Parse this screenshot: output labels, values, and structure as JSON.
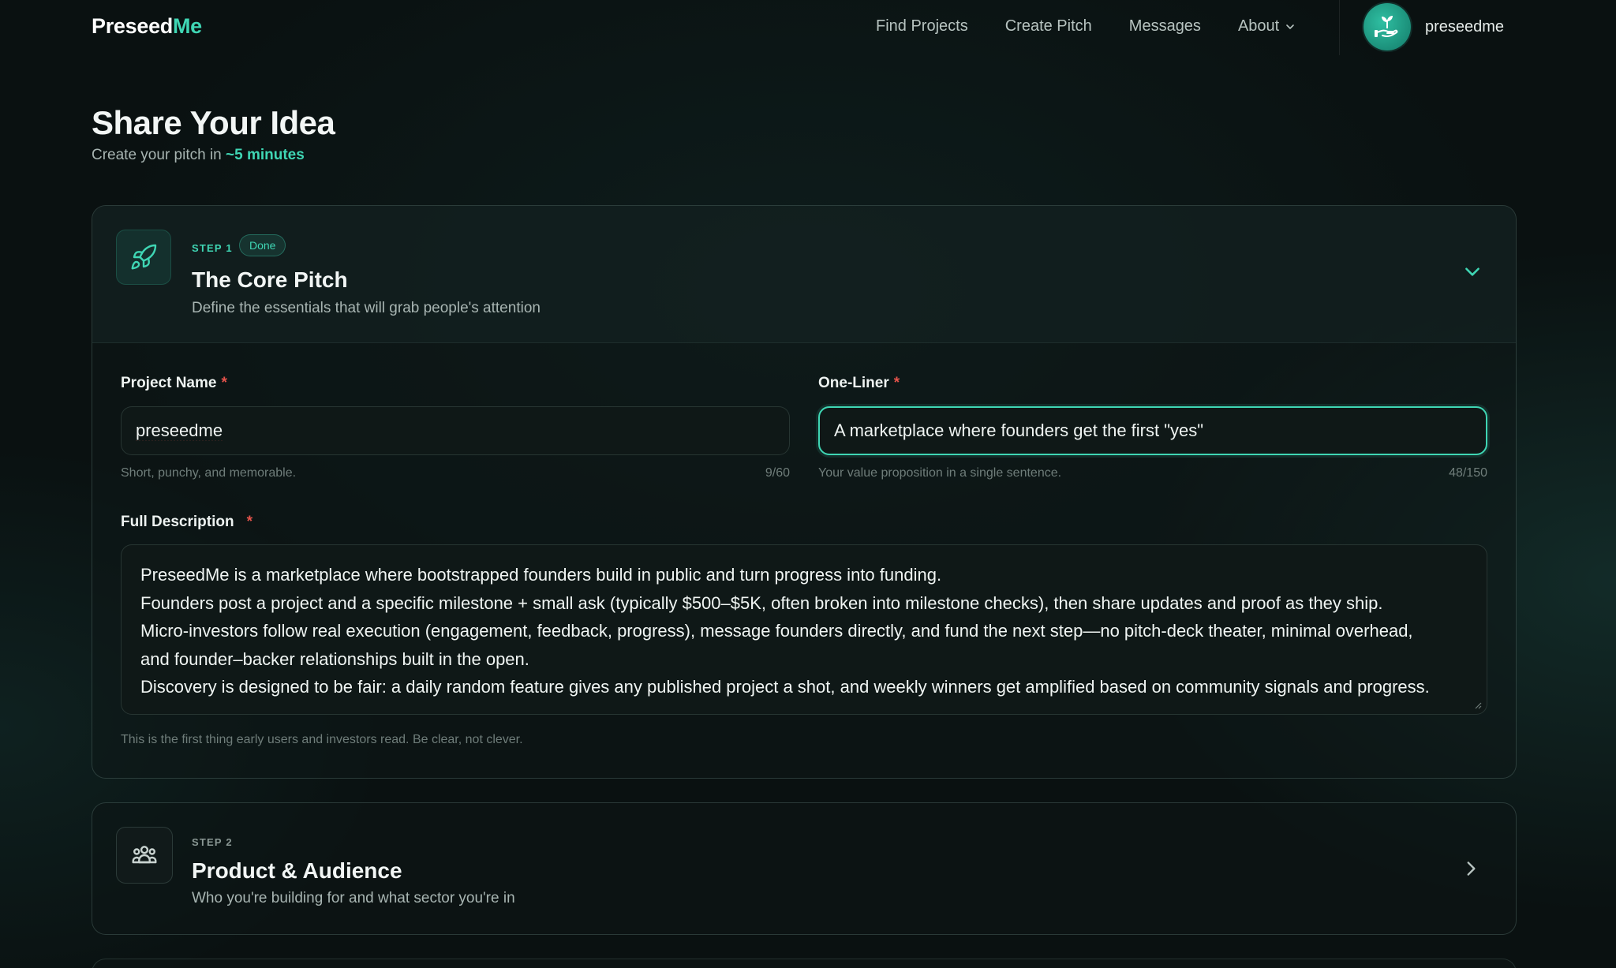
{
  "brand": {
    "name_main": "Preseed",
    "name_accent": "Me",
    "accent_color": "#3fd6b4"
  },
  "nav": {
    "links": [
      "Find Projects",
      "Create Pitch",
      "Messages",
      "About"
    ],
    "user": "preseedme"
  },
  "page": {
    "title": "Share Your Idea",
    "subtitle_prefix": "Create your pitch in ",
    "subtitle_highlight": "~5 minutes"
  },
  "step1": {
    "step_label": "STEP 1",
    "badge": "Done",
    "title": "The Core Pitch",
    "subtitle": "Define the essentials that will grab people's attention",
    "icon": "rocket-icon",
    "project_name": {
      "label": "Project Name",
      "required_mark": "*",
      "value": "preseedme",
      "hint": "Short, punchy, and memorable.",
      "counter": "9/60"
    },
    "one_liner": {
      "label": "One-Liner",
      "required_mark": "*",
      "value": "A marketplace where founders get the first \"yes\"",
      "hint": "Your value proposition in a single sentence.",
      "counter": "48/150"
    },
    "description": {
      "label": "Full Description",
      "required_mark": "*",
      "lines": [
        "PreseedMe is a marketplace where bootstrapped founders build in public and turn progress into funding.",
        "Founders post a project and a specific milestone + small ask (typically $500–$5K, often broken into milestone checks), then share updates and proof as they ship.",
        "Micro-investors follow real execution (engagement, feedback, progress), message founders directly, and fund the next step—no pitch-deck theater, minimal overhead,",
        "and founder–backer relationships built in the open.",
        "Discovery is designed to be fair: a daily random feature gives any published project a shot, and weekly winners get amplified based on community signals and progress."
      ],
      "hint": "This is the first thing early users and investors read. Be clear, not clever."
    }
  },
  "step2": {
    "step_label": "STEP 2",
    "title": "Product & Audience",
    "subtitle": "Who you're building for and what sector you're in",
    "icon": "users-icon"
  }
}
